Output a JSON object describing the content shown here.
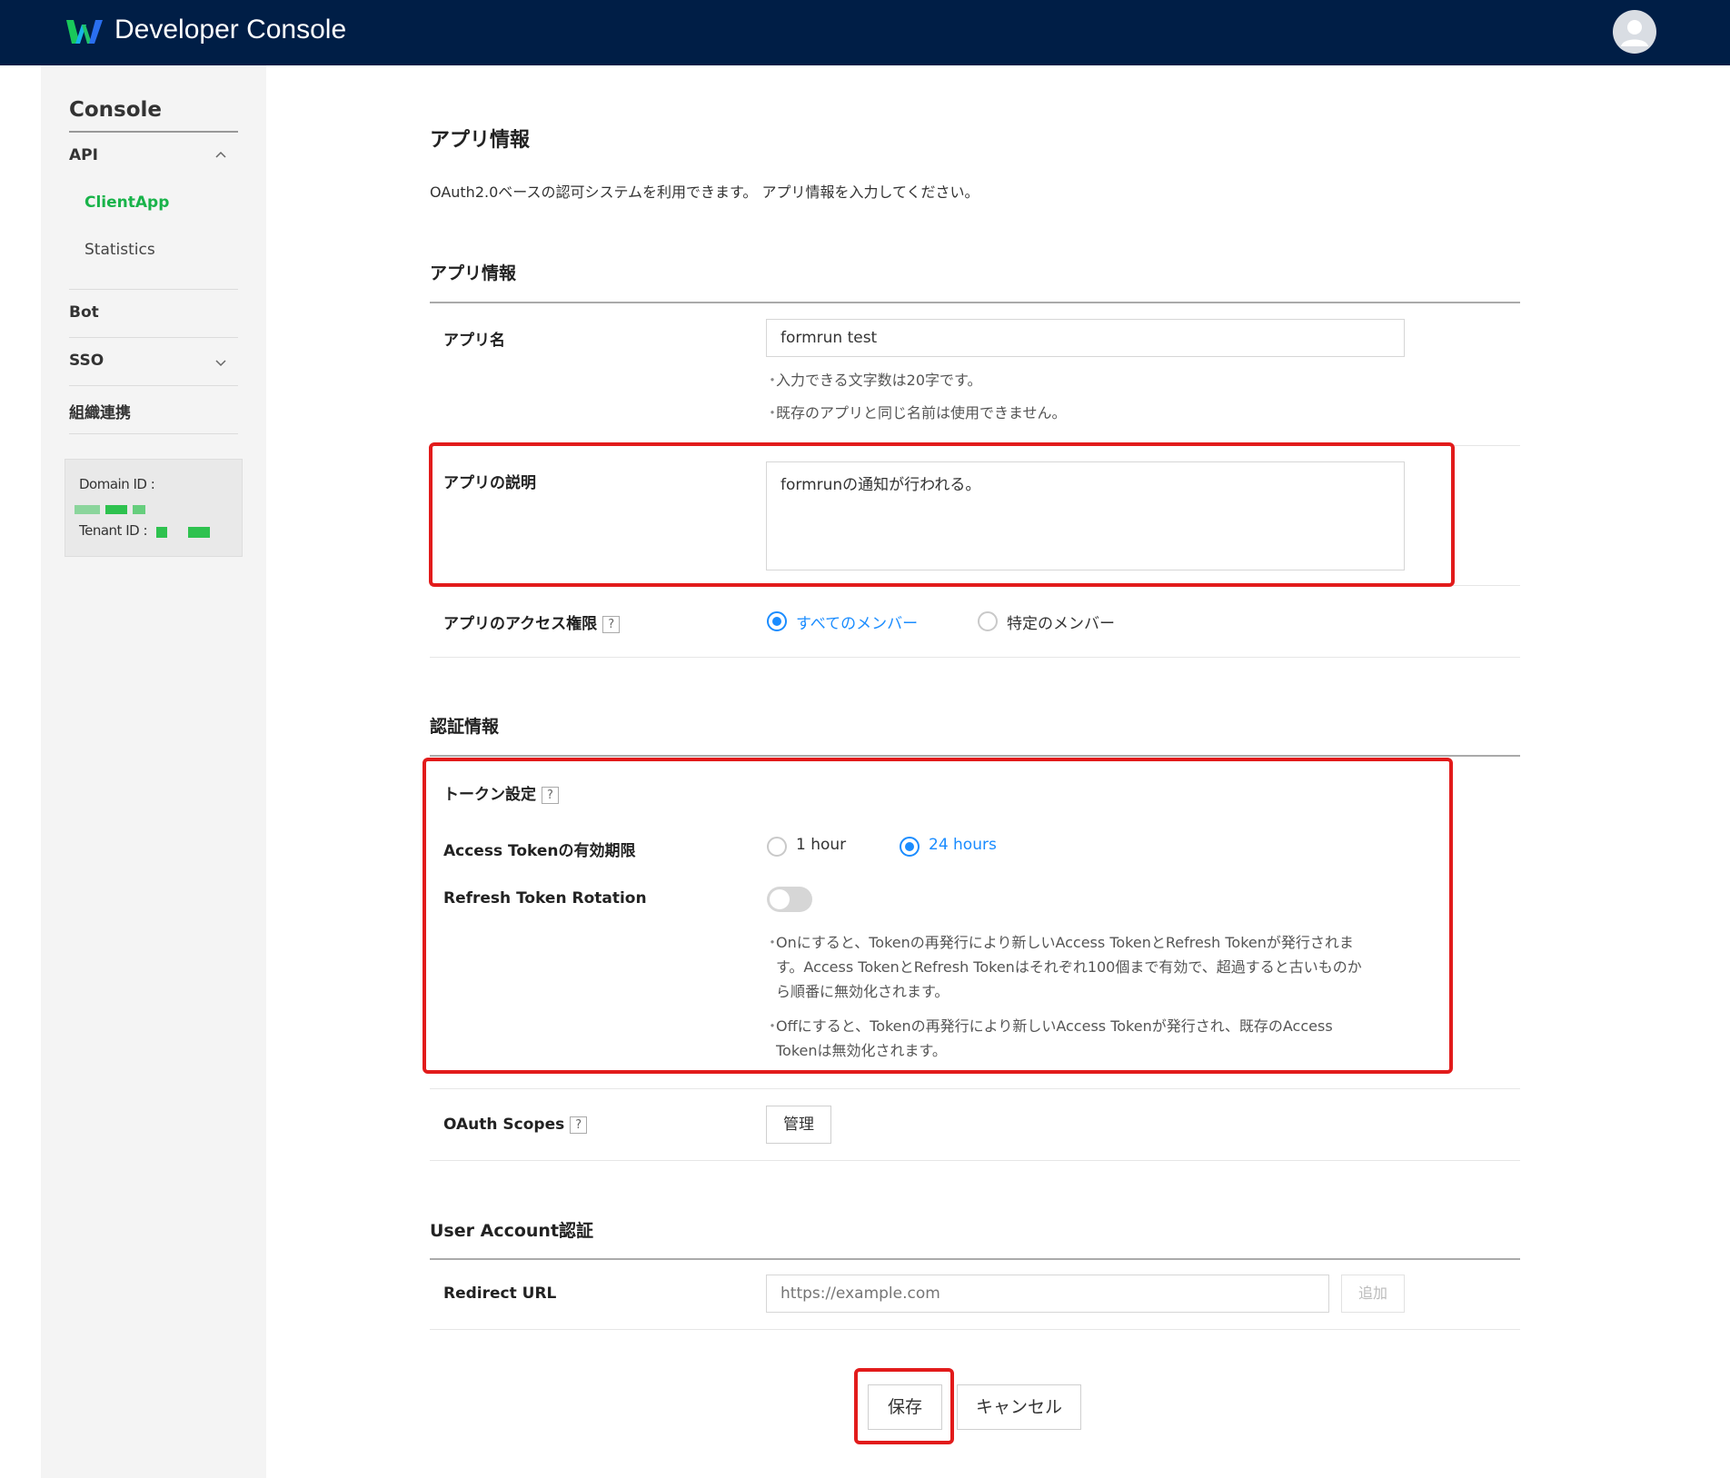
{
  "header": {
    "title": "Developer Console"
  },
  "sidebar": {
    "title": "Console",
    "api_label": "API",
    "client_app_label": "ClientApp",
    "statistics_label": "Statistics",
    "bot_label": "Bot",
    "sso_label": "SSO",
    "org_label": "組織連携",
    "domain_id_label": "Domain ID :",
    "tenant_id_label": "Tenant ID :"
  },
  "page": {
    "heading": "アプリ情報",
    "description": "OAuth2.0ベースの認可システムを利用できます。 アプリ情報を入力してください。"
  },
  "app_info": {
    "section_title": "アプリ情報",
    "name_label": "アプリ名",
    "name_value": "formrun test",
    "name_note_1": "入力できる文字数は20字です。",
    "name_note_2": "既存のアプリと同じ名前は使用できません。",
    "desc_label": "アプリの説明",
    "desc_value": "formrunの通知が行われる。",
    "access_label": "アプリのアクセス権限",
    "access_help": "?",
    "access_option_all": "すべてのメンバー",
    "access_option_specific": "特定のメンバー"
  },
  "auth": {
    "section_title": "認証情報",
    "token_settings_label": "トークン設定",
    "token_help": "?",
    "access_token_label": "Access Tokenの有効期限",
    "option_1h": "1 hour",
    "option_24h": "24 hours",
    "refresh_label": "Refresh Token Rotation",
    "refresh_on": false,
    "refresh_note_1a": "Onにすると、Tokenの再発行により新しいAccess TokenとRefresh Tokenが発行されま",
    "refresh_note_1b": "す。Access TokenとRefresh Tokenはそれぞれ100個まで有効で、超過すると古いものか",
    "refresh_note_1c": "ら順番に無効化されます。",
    "refresh_note_2a": "Offにすると、Tokenの再発行により新しいAccess Tokenが発行され、既存のAccess",
    "refresh_note_2b": "Tokenは無効化されます。",
    "scopes_label": "OAuth Scopes",
    "scopes_help": "?",
    "manage_button": "管理"
  },
  "user_account": {
    "section_title": "User Account認証",
    "redirect_label": "Redirect URL",
    "redirect_placeholder": "https://example.com",
    "add_button": "追加"
  },
  "footer": {
    "save_button": "保存",
    "cancel_button": "キャンセル"
  },
  "colors": {
    "header_bg": "#001e46",
    "accent_green": "#19b34a",
    "accent_blue": "#1a8cff",
    "highlight_red": "#e21b1b"
  }
}
